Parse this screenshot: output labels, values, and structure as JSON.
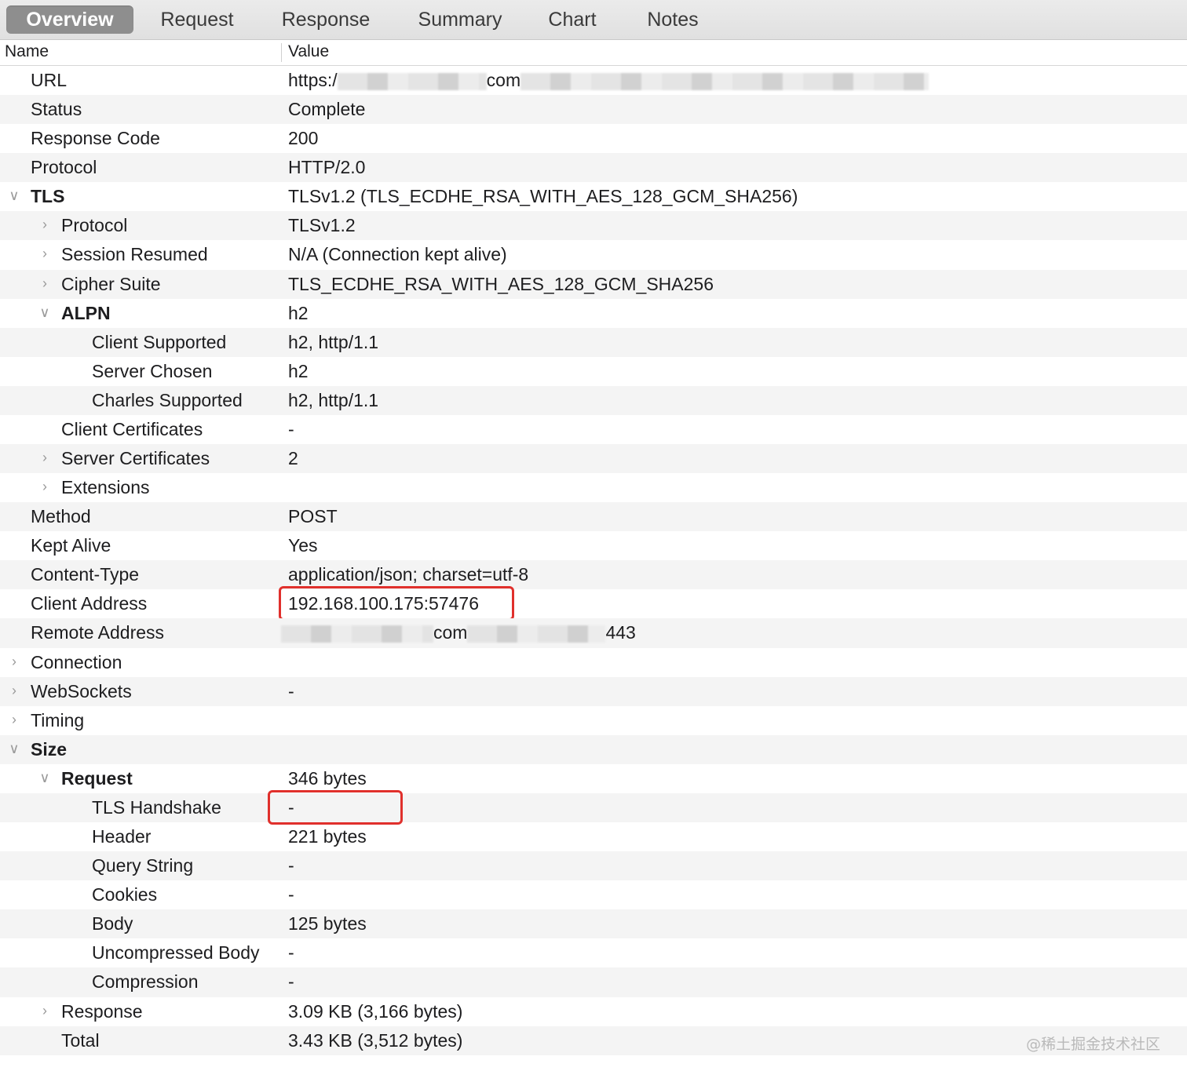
{
  "tabs": [
    {
      "label": "Overview",
      "active": true
    },
    {
      "label": "Request",
      "active": false
    },
    {
      "label": "Response",
      "active": false
    },
    {
      "label": "Summary",
      "active": false
    },
    {
      "label": "Chart",
      "active": false
    },
    {
      "label": "Notes",
      "active": false
    }
  ],
  "columns": {
    "name": "Name",
    "value": "Value"
  },
  "rows": [
    {
      "name": "URL",
      "value": "https:/",
      "level": 0,
      "disclosure": "none",
      "url_suffix": "com"
    },
    {
      "name": "Status",
      "value": "Complete",
      "level": 0,
      "disclosure": "none"
    },
    {
      "name": "Response Code",
      "value": "200",
      "level": 0,
      "disclosure": "none"
    },
    {
      "name": "Protocol",
      "value": "HTTP/2.0",
      "level": 0,
      "disclosure": "none"
    },
    {
      "name": "TLS",
      "value": "TLSv1.2 (TLS_ECDHE_RSA_WITH_AES_128_GCM_SHA256)",
      "level": 0,
      "disclosure": "expanded",
      "bold": true
    },
    {
      "name": "Protocol",
      "value": "TLSv1.2",
      "level": 1,
      "disclosure": "collapsed"
    },
    {
      "name": "Session Resumed",
      "value": "N/A (Connection kept alive)",
      "level": 1,
      "disclosure": "collapsed"
    },
    {
      "name": "Cipher Suite",
      "value": "TLS_ECDHE_RSA_WITH_AES_128_GCM_SHA256",
      "level": 1,
      "disclosure": "collapsed"
    },
    {
      "name": "ALPN",
      "value": "h2",
      "level": 1,
      "disclosure": "expanded",
      "bold": true
    },
    {
      "name": "Client Supported",
      "value": "h2, http/1.1",
      "level": 2,
      "disclosure": "none"
    },
    {
      "name": "Server Chosen",
      "value": "h2",
      "level": 2,
      "disclosure": "none"
    },
    {
      "name": "Charles Supported",
      "value": "h2, http/1.1",
      "level": 2,
      "disclosure": "none"
    },
    {
      "name": "Client Certificates",
      "value": "-",
      "level": 1,
      "disclosure": "none"
    },
    {
      "name": "Server Certificates",
      "value": "2",
      "level": 1,
      "disclosure": "collapsed"
    },
    {
      "name": "Extensions",
      "value": "",
      "level": 1,
      "disclosure": "collapsed"
    },
    {
      "name": "Method",
      "value": "POST",
      "level": 0,
      "disclosure": "none"
    },
    {
      "name": "Kept Alive",
      "value": "Yes",
      "level": 0,
      "disclosure": "none"
    },
    {
      "name": "Content-Type",
      "value": "application/json; charset=utf-8",
      "level": 0,
      "disclosure": "none"
    },
    {
      "name": "Client Address",
      "value": "192.168.100.175:57476",
      "level": 0,
      "disclosure": "none",
      "highlight": true
    },
    {
      "name": "Remote Address",
      "value": "com",
      "level": 0,
      "disclosure": "none",
      "port": "443"
    },
    {
      "name": "Connection",
      "value": "",
      "level": 0,
      "disclosure": "collapsed"
    },
    {
      "name": "WebSockets",
      "value": "-",
      "level": 0,
      "disclosure": "collapsed"
    },
    {
      "name": "Timing",
      "value": "",
      "level": 0,
      "disclosure": "collapsed"
    },
    {
      "name": "Size",
      "value": "",
      "level": 0,
      "disclosure": "expanded",
      "bold": true
    },
    {
      "name": "Request",
      "value": "346 bytes",
      "level": 1,
      "disclosure": "expanded",
      "bold": true
    },
    {
      "name": "TLS Handshake",
      "value": "-",
      "level": 2,
      "disclosure": "none",
      "highlight": true
    },
    {
      "name": "Header",
      "value": "221 bytes",
      "level": 2,
      "disclosure": "none"
    },
    {
      "name": "Query String",
      "value": "-",
      "level": 2,
      "disclosure": "none"
    },
    {
      "name": "Cookies",
      "value": "-",
      "level": 2,
      "disclosure": "none"
    },
    {
      "name": "Body",
      "value": "125 bytes",
      "level": 2,
      "disclosure": "none"
    },
    {
      "name": "Uncompressed Body",
      "value": "-",
      "level": 2,
      "disclosure": "none"
    },
    {
      "name": "Compression",
      "value": "-",
      "level": 2,
      "disclosure": "none"
    },
    {
      "name": "Response",
      "value": "3.09 KB (3,166 bytes)",
      "level": 1,
      "disclosure": "collapsed"
    },
    {
      "name": "Total",
      "value": "3.43 KB (3,512 bytes)",
      "level": 1,
      "disclosure": "none"
    }
  ],
  "watermark": "@稀土掘金技术社区",
  "colors": {
    "highlight": "#e0302c",
    "active_tab": "#8e8e8e",
    "row_alt": "#f4f4f4"
  }
}
